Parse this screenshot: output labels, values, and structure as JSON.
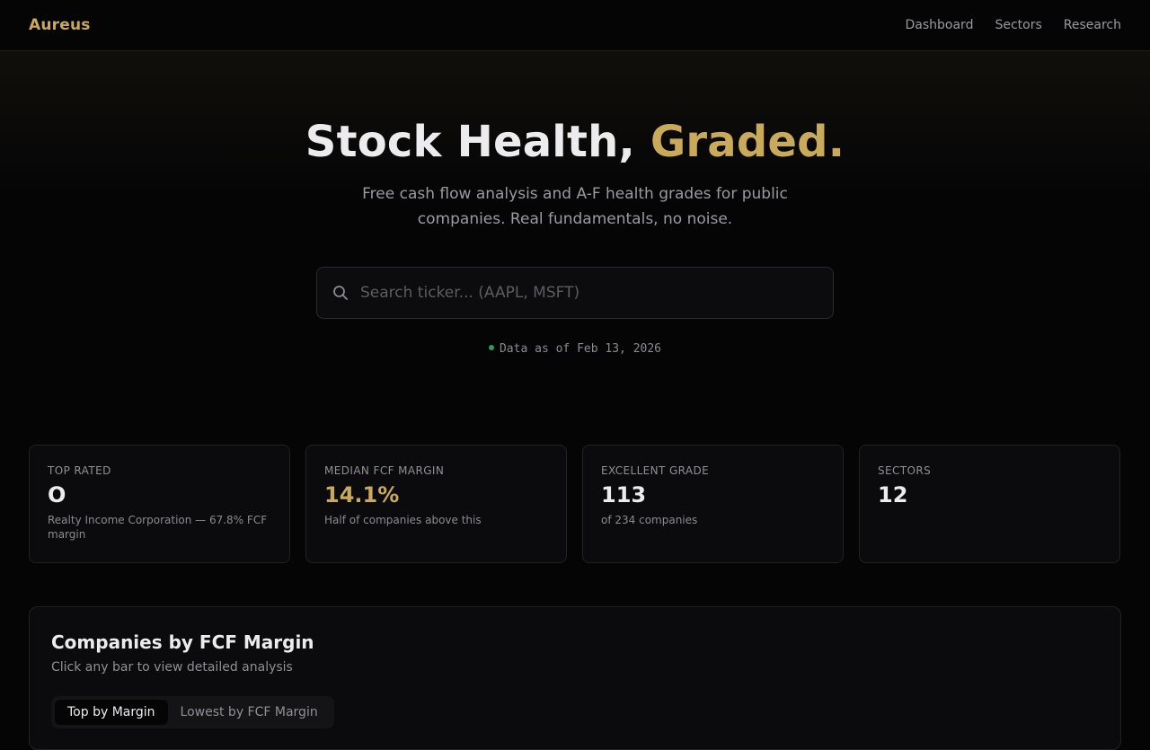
{
  "brand": "Aureus",
  "nav": [
    "Dashboard",
    "Sectors",
    "Research"
  ],
  "hero": {
    "title_main": "Stock Health, ",
    "title_accent": "Graded.",
    "subtitle": "Free cash flow analysis and A-F health grades for public companies. Real fundamentals, no noise."
  },
  "search": {
    "placeholder": "Search ticker... (AAPL, MSFT)",
    "value": "",
    "icon": "search-icon"
  },
  "data_as_of": "Data as of Feb 13, 2026",
  "stats": [
    {
      "label": "TOP RATED",
      "value": "O",
      "note": "Realty Income Corporation — 67.8% FCF margin"
    },
    {
      "label": "MEDIAN FCF MARGIN",
      "value": "14.1%",
      "note": "Half of companies above this"
    },
    {
      "label": "EXCELLENT GRADE",
      "value": "113",
      "note": "of 234 companies"
    },
    {
      "label": "SECTORS",
      "value": "12",
      "note": ""
    }
  ],
  "chart_section": {
    "title": "Companies by FCF Margin",
    "subtitle": "Click any bar to view detailed analysis",
    "tabs": [
      "Top by Margin",
      "Lowest by FCF Margin"
    ],
    "active_tab": "Top by Margin"
  },
  "colors": {
    "accent": "#c9a95a",
    "status_dot": "#2e9a6a",
    "background": "#050506"
  }
}
